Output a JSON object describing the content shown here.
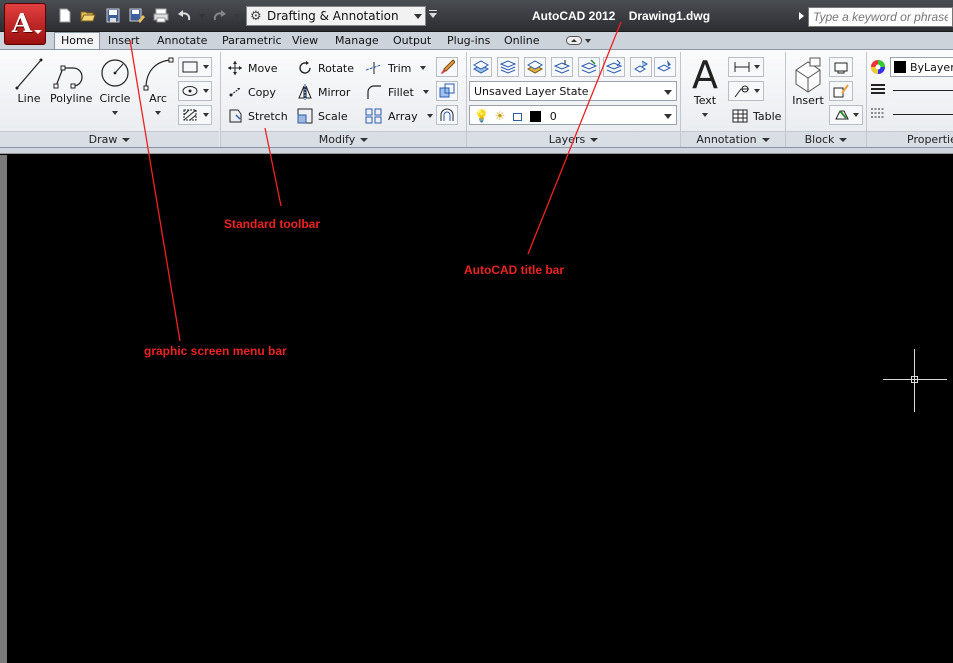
{
  "window": {
    "app_name": "AutoCAD 2012",
    "document": "Drawing1.dwg",
    "search_placeholder": "Type a keyword or phrase",
    "workspace": "Drafting & Annotation"
  },
  "quick_access_icons": [
    "new-icon",
    "open-icon",
    "save-icon",
    "save-as-icon",
    "plot-icon",
    "undo-icon",
    "redo-icon"
  ],
  "tabs": [
    "Home",
    "Insert",
    "Annotate",
    "Parametric",
    "View",
    "Manage",
    "Output",
    "Plug-ins",
    "Online"
  ],
  "active_tab": "Home",
  "draw": {
    "title": "Draw",
    "line": "Line",
    "polyline": "Polyline",
    "circle": "Circle",
    "arc": "Arc"
  },
  "modify": {
    "title": "Modify",
    "move": "Move",
    "rotate": "Rotate",
    "trim": "Trim",
    "copy": "Copy",
    "mirror": "Mirror",
    "fillet": "Fillet",
    "stretch": "Stretch",
    "scale": "Scale",
    "array": "Array"
  },
  "layers": {
    "title": "Layers",
    "layer_state": "Unsaved Layer State",
    "current_layer": "0"
  },
  "annotation": {
    "title": "Annotation",
    "text": "Text",
    "table": "Table"
  },
  "block": {
    "title": "Block",
    "insert": "Insert"
  },
  "properties": {
    "title": "Properties",
    "color": "ByLayer"
  },
  "annotations": {
    "standard_toolbar": "Standard toolbar",
    "title_bar": "AutoCAD title bar",
    "screen_menu": "graphic screen menu bar"
  },
  "colors": {
    "annotation_red": "#ee2222",
    "canvas": "#000000",
    "app_button": "#c41e1e"
  }
}
